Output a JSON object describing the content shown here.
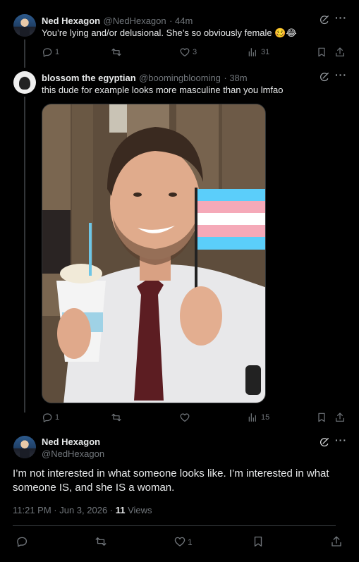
{
  "tweets": [
    {
      "name": "Ned Hexagon",
      "handle": "@NedHexagon",
      "time": "· 44m",
      "text": "You’re lying and/or delusional. She’s so obviously female 🥴😂",
      "replies": "1",
      "likes": "3",
      "views": "31"
    },
    {
      "name": "blossom the egyptian",
      "handle": "@boomingblooming",
      "time": "· 38m",
      "text": "this dude for example looks more masculine than you lmfao",
      "replies": "1",
      "views": "15"
    }
  ],
  "main_tweet": {
    "name": "Ned Hexagon",
    "handle": "@NedHexagon",
    "text": "I’m not interested in what someone looks like. I’m interested in what someone IS, and she IS a woman.",
    "timestamp": "11:21 PM · Jun 3, 2026 · ",
    "views_count": "11",
    "views_label": " Views",
    "likes": "1"
  },
  "icons": {
    "reply": "reply-icon",
    "retweet": "retweet-icon",
    "like": "heart-icon",
    "views": "views-icon",
    "bookmark": "bookmark-icon",
    "share": "share-icon",
    "grok": "grok-icon",
    "more": "more-icon"
  },
  "colors": {
    "background": "#000000",
    "text": "#e7e9ea",
    "muted": "#71767b",
    "border": "#2f3336"
  }
}
